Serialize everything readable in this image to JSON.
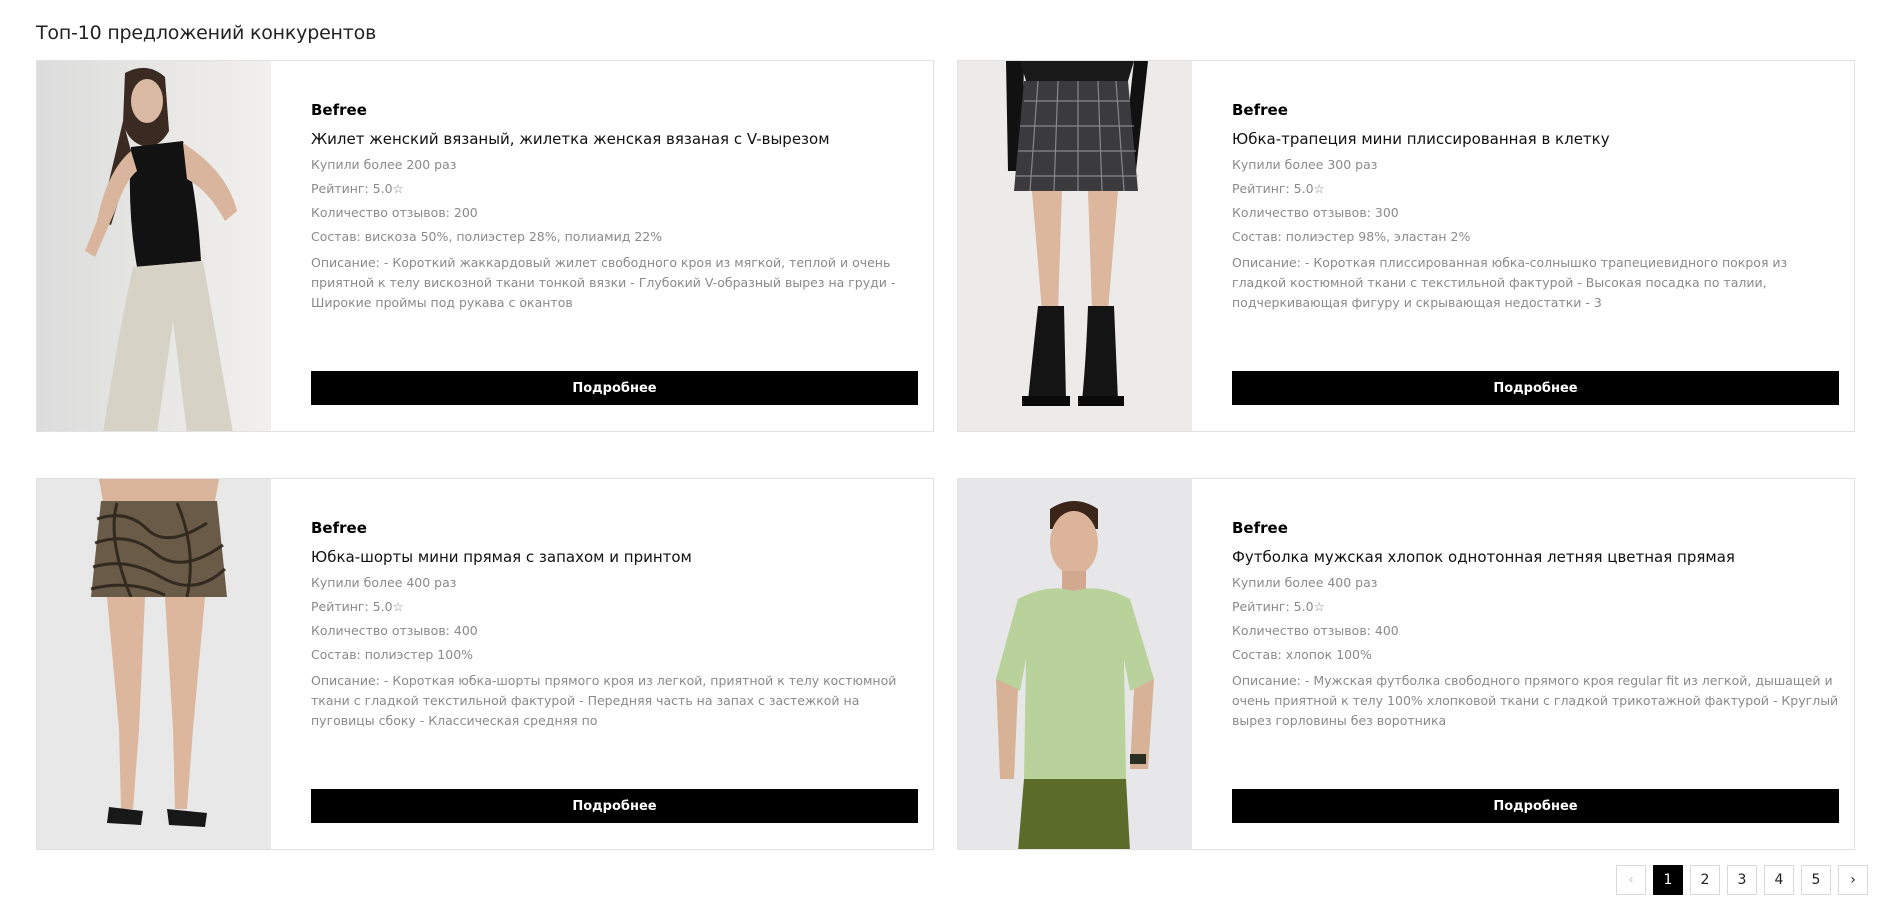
{
  "header": {
    "title": "Топ-10 предложений конкурентов"
  },
  "labels": {
    "bought_prefix": "Купили более",
    "rating_prefix": "Рейтинг:",
    "reviews_prefix": "Количество отзывов:",
    "composition_prefix": "Состав:",
    "description_prefix": "Описание:",
    "details_button": "Подробнее"
  },
  "cards": [
    {
      "brand": "Befree",
      "name": "Жилет женский вязаный, жилетка женская вязаная с V-вырезом",
      "bought": "Купили более 200 раз",
      "rating": "Рейтинг: 5.0☆",
      "reviews": "Количество отзывов: 200",
      "composition": "Состав: вискоза 50%, полиэстер 28%, полиамид 22%",
      "description": "Описание: - Короткий жаккардовый жилет свободного кроя из мягкой, теплой и очень приятной к телу вискозной ткани тонкой вязки - Глубокий V-образный вырез на груди - Широкие проймы под рукава с окантов",
      "button": "Подробнее",
      "photo_icon": "woman-in-black-vest-photo"
    },
    {
      "brand": "Befree",
      "name": "Юбка-трапеция мини плиссированная в клетку",
      "bought": "Купили более 300 раз",
      "rating": "Рейтинг: 5.0☆",
      "reviews": "Количество отзывов: 300",
      "composition": "Состав: полиэстер 98%, эластан 2%",
      "description": "Описание: - Короткая плиссированная юбка-солнышко трапециевидного покроя из гладкой костюмной ткани с текстильной фактурой - Высокая посадка по талии, подчеркивающая фигуру и скрывающая недостатки - 3",
      "button": "Подробнее",
      "photo_icon": "plaid-skirt-boots-photo"
    },
    {
      "brand": "Befree",
      "name": "Юбка-шорты мини прямая с запахом и принтом",
      "bought": "Купили более 400 раз",
      "rating": "Рейтинг: 5.0☆",
      "reviews": "Количество отзывов: 400",
      "composition": "Состав: полиэстер 100%",
      "description": "Описание: - Короткая юбка-шорты прямого кроя из легкой, приятной к телу костюмной ткани с гладкой текстильной фактурой - Передняя часть на запах с застежкой на пуговицы сбоку - Классическая средняя по",
      "button": "Подробнее",
      "photo_icon": "printed-skort-photo"
    },
    {
      "brand": "Befree",
      "name": "Футболка мужская хлопок однотонная летняя цветная прямая",
      "bought": "Купили более 400 раз",
      "rating": "Рейтинг: 5.0☆",
      "reviews": "Количество отзывов: 400",
      "composition": "Состав: хлопок 100%",
      "description": "Описание: - Мужская футболка свободного прямого кроя regular fit из легкой, дышащей и очень приятной к телу 100% хлопковой ткани с гладкой трикотажной фактурой - Круглый вырез горловины без воротника",
      "button": "Подробнее",
      "photo_icon": "man-green-tshirt-photo"
    }
  ],
  "pagination": {
    "prev": "‹",
    "next": "›",
    "pages": [
      "1",
      "2",
      "3",
      "4",
      "5"
    ],
    "current": "1"
  },
  "colors": {
    "button_bg": "#000000",
    "button_text": "#ffffff",
    "muted_text": "#8a8a8a",
    "border": "#e2e2e2"
  }
}
